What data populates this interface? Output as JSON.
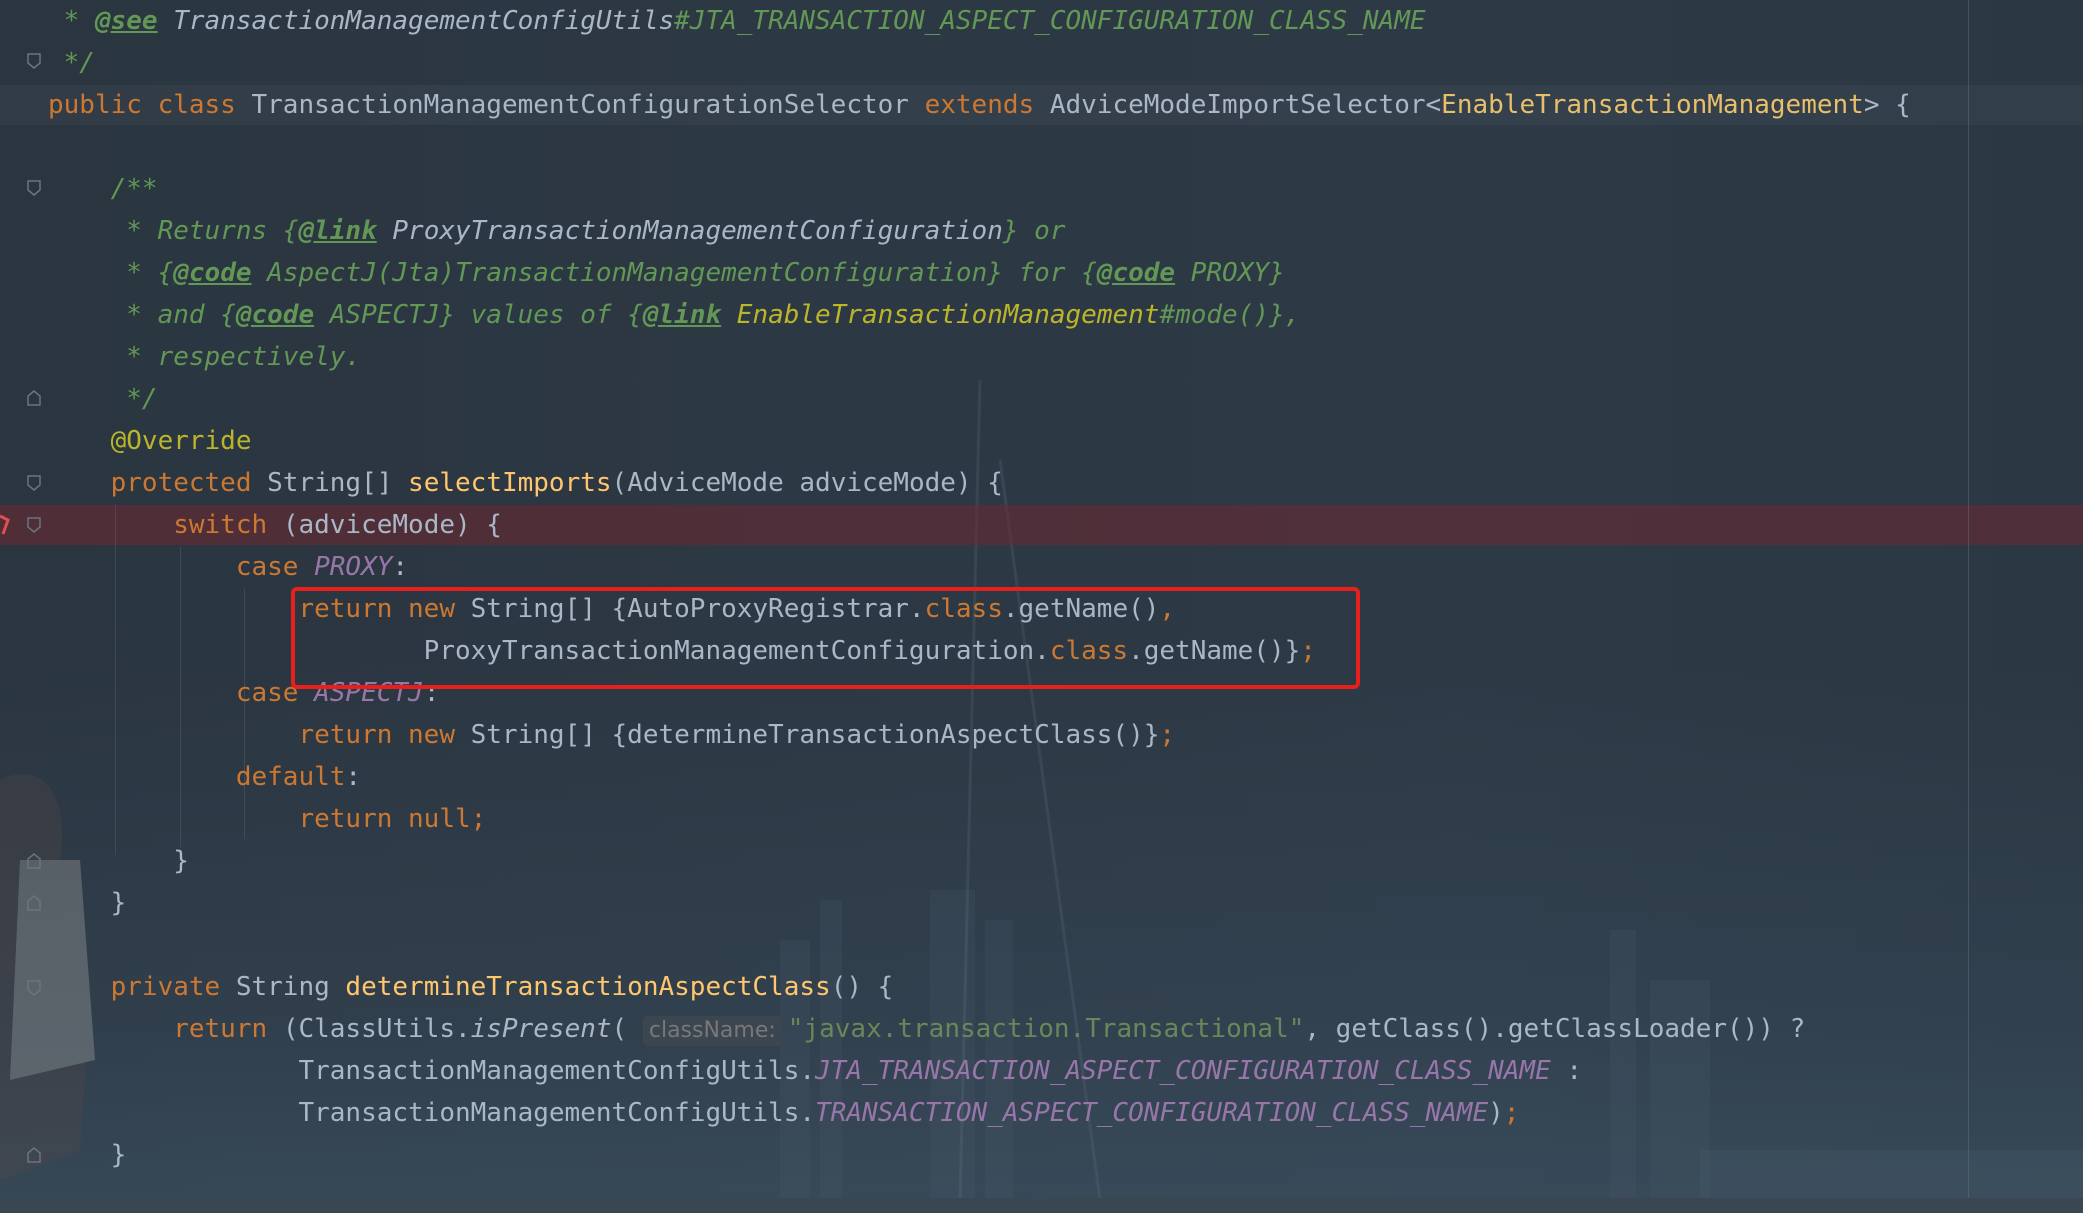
{
  "editor": {
    "lines": [
      {
        "parts": [
          {
            "t": " * ",
            "c": "cm"
          },
          {
            "t": "@see",
            "c": "tag"
          },
          {
            "t": " ",
            "c": "cm"
          },
          {
            "t": "TransactionManagementConfigUtils",
            "c": "cmref"
          },
          {
            "t": "#JTA_TRANSACTION_ASPECT_CONFIGURATION_CLASS_NAME",
            "c": "cm"
          }
        ]
      },
      {
        "parts": [
          {
            "t": " */",
            "c": "cm"
          }
        ]
      },
      {
        "parts": [
          {
            "t": "public class ",
            "c": "kw"
          },
          {
            "t": "TransactionManagementConfigurationSelector ",
            "c": ""
          },
          {
            "t": "extends ",
            "c": "kw"
          },
          {
            "t": "AdviceModeImportSelector<",
            "c": ""
          },
          {
            "t": "EnableTransactionManagement",
            "c": "gen"
          },
          {
            "t": "> {",
            "c": ""
          }
        ]
      },
      {
        "parts": [
          {
            "t": "",
            "c": ""
          }
        ]
      },
      {
        "parts": [
          {
            "t": "    /**",
            "c": "cm"
          }
        ]
      },
      {
        "parts": [
          {
            "t": "     * Returns {",
            "c": "cm"
          },
          {
            "t": "@link",
            "c": "tag"
          },
          {
            "t": " ProxyTransactionManagementConfiguration",
            "c": "cmref"
          },
          {
            "t": "} or",
            "c": "cm"
          }
        ]
      },
      {
        "parts": [
          {
            "t": "     * {",
            "c": "cm"
          },
          {
            "t": "@code",
            "c": "tag"
          },
          {
            "t": " AspectJ(Jta)TransactionManagementConfiguration} for {",
            "c": "cm"
          },
          {
            "t": "@code",
            "c": "tag"
          },
          {
            "t": " PROXY}",
            "c": "cm"
          }
        ]
      },
      {
        "parts": [
          {
            "t": "     * and {",
            "c": "cm"
          },
          {
            "t": "@code",
            "c": "tag"
          },
          {
            "t": " ASPECTJ} values of {",
            "c": "cm"
          },
          {
            "t": "@link",
            "c": "tag"
          },
          {
            "t": " EnableTransactionManagement",
            "c": "cmy"
          },
          {
            "t": "#mode()},",
            "c": "cm"
          }
        ]
      },
      {
        "parts": [
          {
            "t": "     * respectively.",
            "c": "cm"
          }
        ]
      },
      {
        "parts": [
          {
            "t": "     */",
            "c": "cm"
          }
        ]
      },
      {
        "parts": [
          {
            "t": "    @Override",
            "c": "ann"
          }
        ]
      },
      {
        "parts": [
          {
            "t": "    protected ",
            "c": "kw"
          },
          {
            "t": "String[] ",
            "c": ""
          },
          {
            "t": "selectImports",
            "c": "fn"
          },
          {
            "t": "(AdviceMode adviceMode) {",
            "c": ""
          }
        ]
      },
      {
        "parts": [
          {
            "t": "        switch ",
            "c": "kw"
          },
          {
            "t": "(adviceMode) {",
            "c": ""
          }
        ]
      },
      {
        "parts": [
          {
            "t": "            case ",
            "c": "kw"
          },
          {
            "t": "PROXY",
            "c": "cst"
          },
          {
            "t": ":",
            "c": ""
          }
        ]
      },
      {
        "parts": [
          {
            "t": "                return new ",
            "c": "kw"
          },
          {
            "t": "String[] {AutoProxyRegistrar.",
            "c": ""
          },
          {
            "t": "class",
            "c": "kw"
          },
          {
            "t": ".getName()",
            "c": ""
          },
          {
            "t": ",",
            "c": "kw"
          }
        ]
      },
      {
        "parts": [
          {
            "t": "                        ProxyTransactionManagementConfiguration.",
            "c": ""
          },
          {
            "t": "class",
            "c": "kw"
          },
          {
            "t": ".getName()}",
            "c": ""
          },
          {
            "t": ";",
            "c": "kw"
          }
        ]
      },
      {
        "parts": [
          {
            "t": "            case ",
            "c": "kw"
          },
          {
            "t": "ASPECTJ",
            "c": "cst"
          },
          {
            "t": ":",
            "c": ""
          }
        ]
      },
      {
        "parts": [
          {
            "t": "                return new ",
            "c": "kw"
          },
          {
            "t": "String[] {determineTransactionAspectClass()}",
            "c": ""
          },
          {
            "t": ";",
            "c": "kw"
          }
        ]
      },
      {
        "parts": [
          {
            "t": "            default",
            "c": "kw"
          },
          {
            "t": ":",
            "c": ""
          }
        ]
      },
      {
        "parts": [
          {
            "t": "                return null;",
            "c": "kw"
          }
        ]
      },
      {
        "parts": [
          {
            "t": "        }",
            "c": ""
          }
        ]
      },
      {
        "parts": [
          {
            "t": "    }",
            "c": ""
          }
        ]
      },
      {
        "parts": [
          {
            "t": "",
            "c": ""
          }
        ]
      },
      {
        "parts": [
          {
            "t": "    private ",
            "c": "kw"
          },
          {
            "t": "String ",
            "c": ""
          },
          {
            "t": "determineTransactionAspectClass",
            "c": "fn"
          },
          {
            "t": "() {",
            "c": ""
          }
        ]
      },
      {
        "parts": [
          {
            "t": "        return ",
            "c": "kw"
          },
          {
            "t": "(ClassUtils.",
            "c": ""
          },
          {
            "t": "isPresent",
            "c": "cmref"
          },
          {
            "t": "( ",
            "c": ""
          },
          {
            "t": "className:",
            "c": "hint"
          },
          {
            "t": "\"javax.transaction.Transactional\"",
            "c": "str"
          },
          {
            "t": ", getClass().getClassLoader()) ?",
            "c": ""
          }
        ]
      },
      {
        "parts": [
          {
            "t": "                TransactionManagementConfigUtils.",
            "c": ""
          },
          {
            "t": "JTA_TRANSACTION_ASPECT_CONFIGURATION_CLASS_NAME",
            "c": "cst"
          },
          {
            "t": " :",
            "c": ""
          }
        ]
      },
      {
        "parts": [
          {
            "t": "                TransactionManagementConfigUtils.",
            "c": ""
          },
          {
            "t": "TRANSACTION_ASPECT_CONFIGURATION_CLASS_NAME",
            "c": "cst"
          },
          {
            "t": ")",
            "c": ""
          },
          {
            "t": ";",
            "c": "kw"
          }
        ]
      },
      {
        "parts": [
          {
            "t": "    }",
            "c": ""
          }
        ]
      }
    ]
  }
}
